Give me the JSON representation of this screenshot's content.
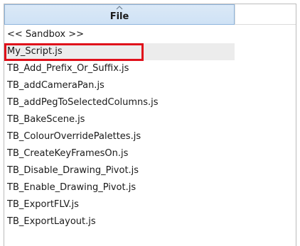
{
  "header": {
    "column_title": "File",
    "sort_icon": "sort-ascending-caret-icon"
  },
  "files": [
    "<< Sandbox >>",
    "My_Script.js",
    "TB_Add_Prefix_Or_Suffix.js",
    "TB_addCameraPan.js",
    "TB_addPegToSelectedColumns.js",
    "TB_BakeScene.js",
    "TB_ColourOverridePalettes.js",
    "TB_CreateKeyFramesOn.js",
    "TB_Disable_Drawing_Pivot.js",
    "TB_Enable_Drawing_Pivot.js",
    "TB_ExportFLV.js",
    "TB_ExportLayout.js"
  ],
  "selected_file": "My_Script.js",
  "colors": {
    "header_bg": "#d4e5f6",
    "header_border": "#8fb6dd",
    "selected_row_bg": "#ececec",
    "highlight_outline": "#e0101a"
  }
}
